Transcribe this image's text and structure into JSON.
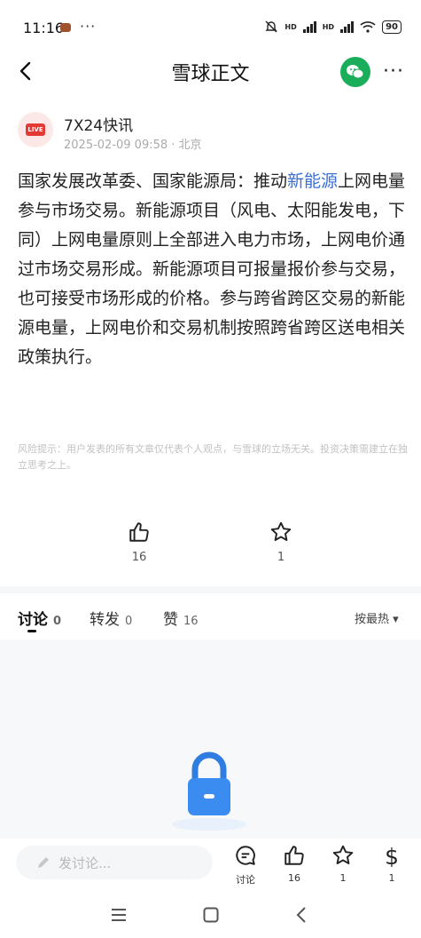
{
  "status": {
    "time": "11:16",
    "dots": "···",
    "network1": "HD",
    "network2": "HD",
    "battery": "90"
  },
  "header": {
    "title": "雪球正文",
    "more": "···"
  },
  "author": {
    "avatar_badge": "LIVE",
    "name": "7X24快讯",
    "meta": "2025-02-09 09:58 · 北京"
  },
  "article": {
    "pre": "国家发展改革委、国家能源局：推动",
    "link": "新能源",
    "post": "上网电量参与市场交易。新能源项目（风电、太阳能发电，下同）上网电量原则上全部进入电力市场，上网电价通过市场交易形成。新能源项目可报量报价参与交易，也可接受市场形成的价格。参与跨省跨区交易的新能源电量，上网电价和交易机制按照跨省跨区送电相关政策执行。"
  },
  "risk_notice": "风险提示：用户发表的所有文章仅代表个人观点，与雪球的立场无关。投资决策需建立在独立思考之上。",
  "stats": {
    "likes": "16",
    "favorites": "1"
  },
  "tabs": [
    {
      "label": "讨论",
      "count": "0"
    },
    {
      "label": "转发",
      "count": "0"
    },
    {
      "label": "赞",
      "count": "16"
    }
  ],
  "sort_label": "按最热 ▾",
  "bottom": {
    "placeholder": "发讨论...",
    "comment_label": "讨论",
    "like_count": "16",
    "fav_count": "1",
    "reward_count": "1"
  },
  "colors": {
    "link": "#3b6fd6",
    "wechat": "#1aad5a",
    "live": "#e53935",
    "lock": "#2f7de1"
  }
}
